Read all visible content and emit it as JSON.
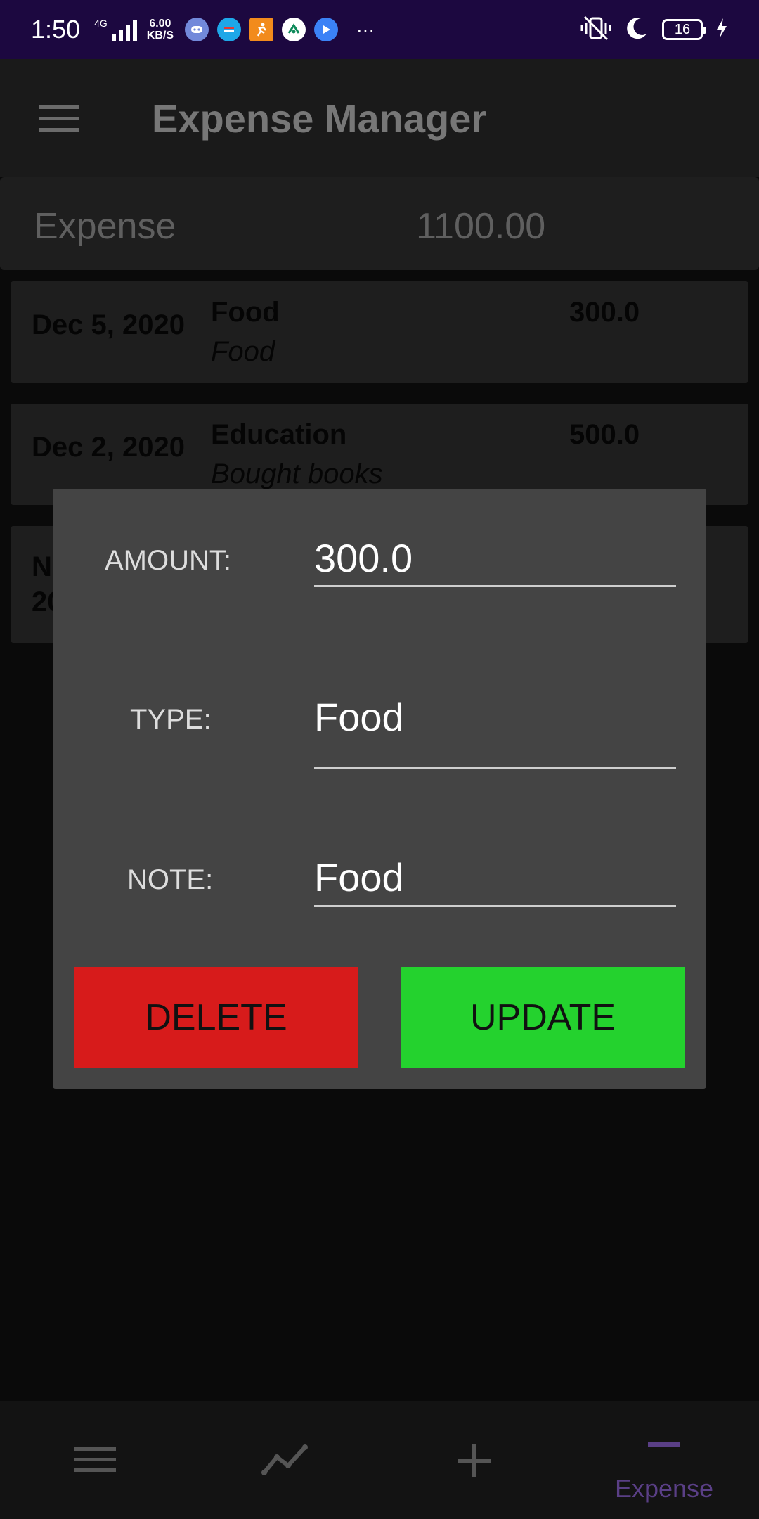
{
  "status_bar": {
    "time": "1:50",
    "network_type": "4G",
    "speed_value": "6.00",
    "speed_unit": "KB/S",
    "battery_level": "16",
    "background": "#1c0840",
    "app_icons": [
      "discord-icon",
      "browser-icon",
      "runner-icon",
      "tracker-icon",
      "play-icon"
    ]
  },
  "app_bar": {
    "title": "Expense Manager",
    "menu_icon": "hamburger-menu-icon"
  },
  "summary": {
    "label": "Expense",
    "total": "1100.00"
  },
  "expenses": [
    {
      "date": "Dec 5, 2020",
      "type": "Food",
      "note": "Food",
      "amount": "300.0"
    },
    {
      "date": "Dec 2, 2020",
      "type": "Education",
      "note": "Bought books",
      "amount": "500.0"
    },
    {
      "date_line1": "N",
      "date_line2": "20"
    }
  ],
  "dialog": {
    "amount_label": "AMOUNT:",
    "amount_value": "300.0",
    "type_label": "TYPE:",
    "type_value": "Food",
    "note_label": "NOTE:",
    "note_value": "Food",
    "delete_label": "DELETE",
    "update_label": "UPDATE",
    "delete_color": "#d71b1b",
    "update_color": "#24d22e"
  },
  "bottom_nav": {
    "items": [
      {
        "icon": "list-icon"
      },
      {
        "icon": "chart-line-icon"
      },
      {
        "icon": "plus-icon"
      },
      {
        "icon": "minus-icon",
        "label": "Expense",
        "active": true
      }
    ],
    "active_color": "#5a3f86"
  }
}
